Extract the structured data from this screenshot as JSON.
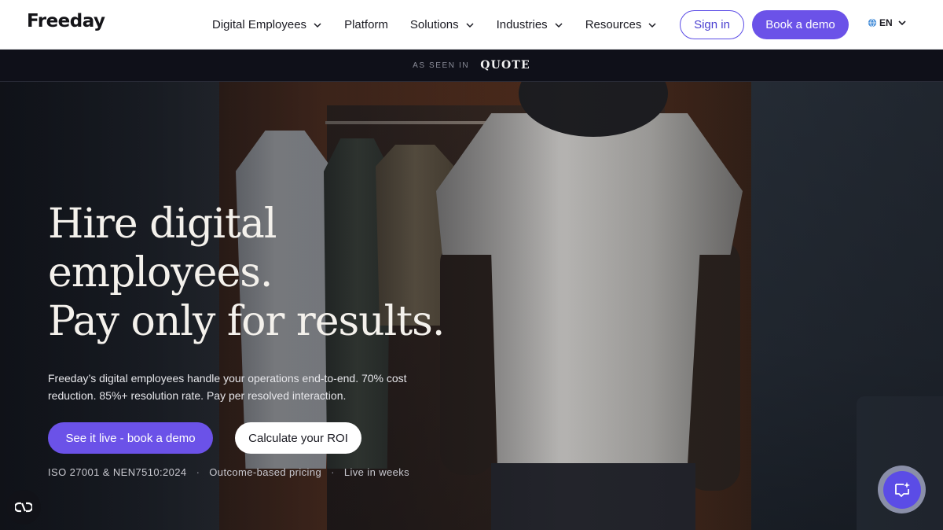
{
  "brand": {
    "logo": "Freeday"
  },
  "nav": {
    "items": [
      {
        "label": "Digital Employees",
        "dropdown": true
      },
      {
        "label": "Platform",
        "dropdown": false
      },
      {
        "label": "Solutions",
        "dropdown": true
      },
      {
        "label": "Industries",
        "dropdown": true
      },
      {
        "label": "Resources",
        "dropdown": true
      }
    ],
    "sign_in": "Sign in",
    "book_demo": "Book a demo",
    "language": "EN"
  },
  "press_bar": {
    "label": "AS SEEN IN",
    "outlet": "QUOTE"
  },
  "hero": {
    "headline": [
      "Hire digital",
      "employees.",
      "Pay only for results."
    ],
    "subtext": "Freeday’s digital employees handle your operations end-to-end. 70% cost reduction. 85%+ resolution rate. Pay per resolved interaction.",
    "cta_primary": "See it live - book a demo",
    "cta_secondary": "Calculate your ROI",
    "badges": [
      "ISO 27001 & NEN7510:2024",
      "Outcome-based pricing",
      "Live in weeks"
    ],
    "badge_separator": "·"
  },
  "colors": {
    "accent": "#6b52e8",
    "nav_bg": "#ffffff",
    "press_bar_bg": "#0f1019",
    "headline_text": "#f4f1ec"
  },
  "icons": {
    "cookie_settings": "cookie-settings-icon",
    "chat": "chat-sparkle-icon",
    "language": "globe-icon",
    "dropdown": "chevron-down-icon"
  }
}
